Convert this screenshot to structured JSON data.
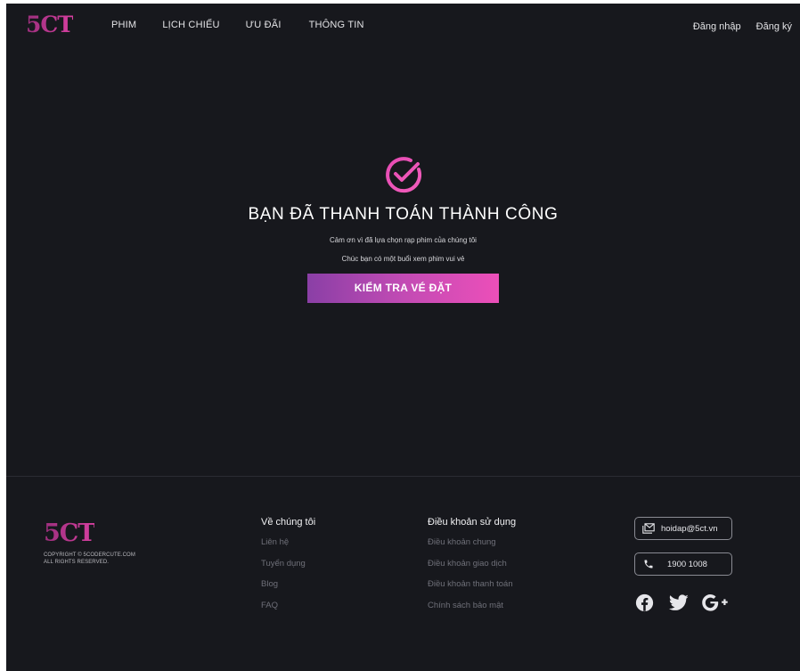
{
  "header": {
    "logo": "5CT",
    "nav": [
      "PHIM",
      "LỊCH CHIẾU",
      "ƯU ĐÃI",
      "THÔNG TIN"
    ],
    "login": "Đăng nhập",
    "register": "Đăng ký"
  },
  "success": {
    "icon": "check-circle-icon",
    "title": "BẠN ĐÃ THANH TOÁN THÀNH CÔNG",
    "thanks": "Cảm ơn vì đã lựa chọn rạp phim của chúng tôi",
    "wish": "Chúc bạn có một buổi xem phim vui vẻ",
    "button": "KIỂM TRA VÉ ĐẶT"
  },
  "footer": {
    "logo": "5CT",
    "copyright_line1": "COPYRIGHT © 5CODERCUTE.COM",
    "copyright_line2": "ALL RIGHTS RESERVED.",
    "about": {
      "title": "Về chúng tôi",
      "links": [
        "Liên hệ",
        "Tuyển dụng",
        "Blog",
        "FAQ"
      ]
    },
    "terms": {
      "title": "Điều khoản sử dụng",
      "links": [
        "Điều khoản chung",
        "Điều khoản giao dịch",
        "Điều khoản thanh toán",
        "Chính sách bảo mật"
      ]
    },
    "contact": {
      "email": "hoidap@5ct.vn",
      "phone": "1900 1008"
    },
    "social": [
      "facebook-icon",
      "twitter-icon",
      "google-plus-icon"
    ]
  },
  "colors": {
    "background": "#17181d",
    "accent_pink": "#ec4fb9",
    "accent_purple": "#8a3fa6"
  }
}
